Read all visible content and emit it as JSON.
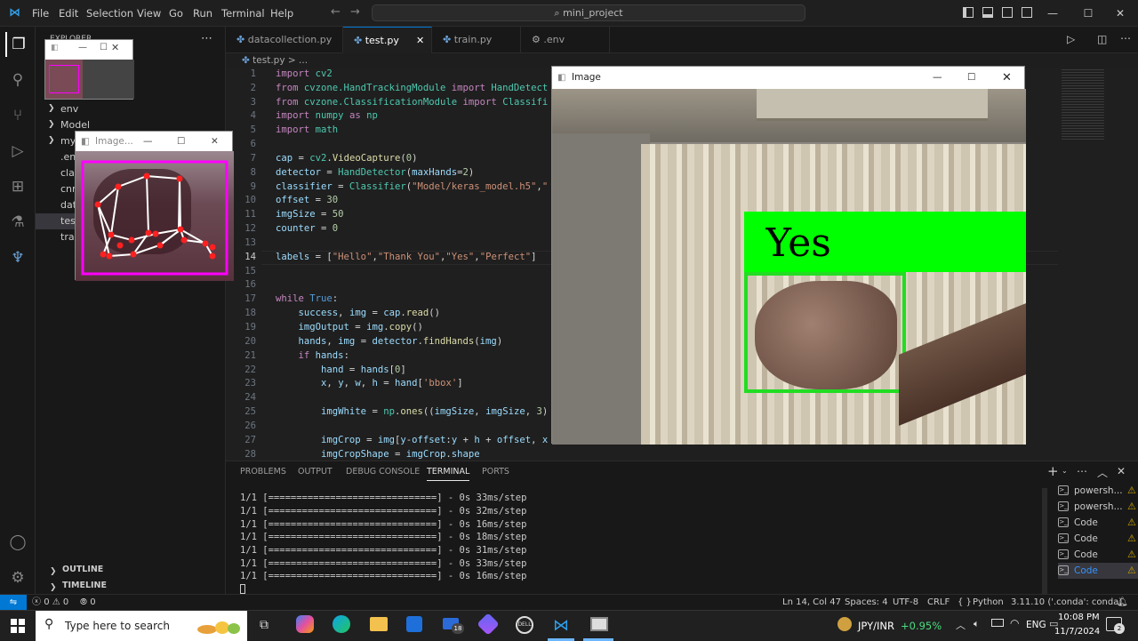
{
  "titlebar": {
    "menus": [
      "File",
      "Edit",
      "Selection",
      "View",
      "Go",
      "Run",
      "Terminal",
      "Help"
    ],
    "search_text": "mini_project"
  },
  "sidebar": {
    "header": "EXPLORER",
    "items": [
      "env",
      "Model",
      "my",
      ".en",
      "clas",
      "cnn",
      "dat",
      "tes",
      "trai"
    ],
    "outline": "OUTLINE",
    "timeline": "TIMELINE"
  },
  "tabs": [
    {
      "label": "datacollection.py",
      "active": false
    },
    {
      "label": "test.py",
      "active": true,
      "close": "✕"
    },
    {
      "label": "train.py",
      "active": false
    },
    {
      "label": ".env",
      "active": false
    }
  ],
  "breadcrumb": {
    "file": "test.py",
    "rest": "> ..."
  },
  "code": {
    "current_line": 14,
    "line_numbers": [
      "1",
      "2",
      "3",
      "4",
      "5",
      "6",
      "7",
      "8",
      "9",
      "10",
      "11",
      "12",
      "13",
      "14",
      "15",
      "16",
      "17",
      "18",
      "19",
      "20",
      "21",
      "22",
      "23",
      "24",
      "25",
      "26",
      "27",
      "28"
    ]
  },
  "panel": {
    "tabs": [
      "PROBLEMS",
      "OUTPUT",
      "DEBUG CONSOLE",
      "TERMINAL",
      "PORTS"
    ],
    "active_tab": "TERMINAL",
    "terminal_lines": [
      "1/1 [==============================] - 0s 33ms/step",
      "1/1 [==============================] - 0s 32ms/step",
      "1/1 [==============================] - 0s 16ms/step",
      "1/1 [==============================] - 0s 18ms/step",
      "1/1 [==============================] - 0s 31ms/step",
      "1/1 [==============================] - 0s 33ms/step",
      "1/1 [==============================] - 0s 16ms/step"
    ],
    "terminals": [
      "powersh...",
      "powersh...",
      "Code",
      "Code",
      "Code",
      "Code"
    ]
  },
  "statusbar": {
    "errors": "0",
    "warnings": "0",
    "ports": "0",
    "position": "Ln 14, Col 47",
    "spaces": "Spaces: 4",
    "encoding": "UTF-8",
    "eol": "CRLF",
    "language": "Python",
    "interpreter": "3.11.10 ('.conda': conda)"
  },
  "windows": {
    "main_image_title": "Image",
    "small_image_title": "Image...",
    "prediction_label": "Yes"
  },
  "taskbar": {
    "search_placeholder": "Type here to search",
    "ticker": "JPY/INR",
    "ticker_change": "+0.95%",
    "lang": "ENG",
    "time": "10:08 PM",
    "date": "11/7/2024",
    "mail_badge": "18",
    "notif_badge": "2"
  },
  "colors": {
    "accent": "#0078d4",
    "prediction_box": "#00ff00",
    "hand_box": "#ff00ff",
    "landmark": "#ff2020"
  }
}
